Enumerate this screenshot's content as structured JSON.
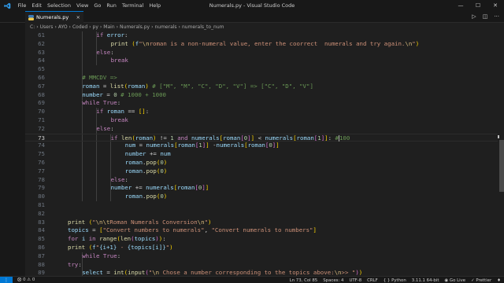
{
  "window": {
    "title": "Numerals.py - Visual Studio Code",
    "menu": [
      "File",
      "Edit",
      "Selection",
      "View",
      "Go",
      "Run",
      "Terminal",
      "Help"
    ]
  },
  "tab": {
    "label": "Numerals.py",
    "close": "×"
  },
  "breadcrumb": [
    "C:",
    "Users",
    "AYO",
    "Coded",
    "py",
    "Main",
    "Numerals.py",
    "numerals",
    "numerals_to_num"
  ],
  "editor": {
    "current_line": 73,
    "lines": [
      {
        "n": "61",
        "indent": 2,
        "html_key": "l61"
      },
      {
        "n": "62",
        "indent": 3
      },
      {
        "n": "63",
        "indent": 2
      },
      {
        "n": "64",
        "indent": 3
      },
      {
        "n": "65",
        "indent": 0
      },
      {
        "n": "66",
        "indent": 1
      },
      {
        "n": "67",
        "indent": 1
      },
      {
        "n": "68",
        "indent": 1
      },
      {
        "n": "69",
        "indent": 1
      },
      {
        "n": "70",
        "indent": 2
      },
      {
        "n": "71",
        "indent": 3
      },
      {
        "n": "72",
        "indent": 2
      },
      {
        "n": "73",
        "indent": 3
      },
      {
        "n": "74",
        "indent": 4
      },
      {
        "n": "75",
        "indent": 4
      },
      {
        "n": "76",
        "indent": 4
      },
      {
        "n": "77",
        "indent": 4
      },
      {
        "n": "78",
        "indent": 3
      },
      {
        "n": "79",
        "indent": 3
      },
      {
        "n": "80",
        "indent": 4
      },
      {
        "n": "81",
        "indent": 0
      },
      {
        "n": "82",
        "indent": 0
      },
      {
        "n": "83",
        "indent": 0
      },
      {
        "n": "84",
        "indent": 0
      },
      {
        "n": "85",
        "indent": 0
      },
      {
        "n": "86",
        "indent": 0
      },
      {
        "n": "87",
        "indent": 1
      },
      {
        "n": "88",
        "indent": 0
      },
      {
        "n": "89",
        "indent": 1
      },
      {
        "n": "90",
        "indent": 2
      }
    ],
    "code_text": {
      "l61": "if error:",
      "l62": "print (f\"\\nroman is a non-numeral value, enter the coorrect  numerals and try again.\\n\")",
      "l63": "else:",
      "l64": "break",
      "l65": "",
      "l66": "# MMCDV =>",
      "l67": "roman = list(roman) # [\"M\", \"M\", \"C\", \"D\", \"V\"] => [\"C\", \"D\", \"V\"]",
      "l68": "number = 0 # 1000 + 1000",
      "l69": "while True:",
      "l70": "if roman == []:",
      "l71": "break",
      "l72": "else:",
      "l73": "if len(roman) != 1 and numerals[roman[0]] < numerals[roman[1]]: #100",
      "l74": "num = numerals[roman[1]] -numerals[roman[0]]",
      "l75": "number += num",
      "l76": "roman.pop(0)",
      "l77": "roman.pop(0)",
      "l78": "else:",
      "l79": "number += numerals[roman[0]]",
      "l80": "roman.pop(0)",
      "l81": "",
      "l82": "",
      "l83": "print (\"\\n\\tRoman Numerals Conversion\\n\")",
      "l84": "topics = [\"Convert numbers to numerals\", \"Convert numerals to numbers\"]",
      "l85": "for i in range(len(topics)):",
      "l86": "print (f\"{i+1} - {topics[i]}\")",
      "l87": "while True:",
      "l88": "try:",
      "l89": "select = int(input(\"\\n Chose a number corresponding to the topics above:\\n>> \"))",
      "l90": ""
    }
  },
  "statusbar": {
    "errors": "0",
    "warnings": "0",
    "position": "Ln 73, Col 85",
    "spaces": "Spaces: 4",
    "encoding": "UTF-8",
    "eol": "CRLF",
    "language": "Python",
    "interpreter": "3.11.1 64-bit",
    "golive": "Go Live",
    "prettier": "Prettier"
  },
  "colors": {
    "accent": "#0078d4",
    "keyword": "#c586c0",
    "string": "#ce9178",
    "function": "#dcdcaa",
    "variable": "#9cdcfe",
    "comment": "#6a9955",
    "number": "#b5cea8"
  }
}
